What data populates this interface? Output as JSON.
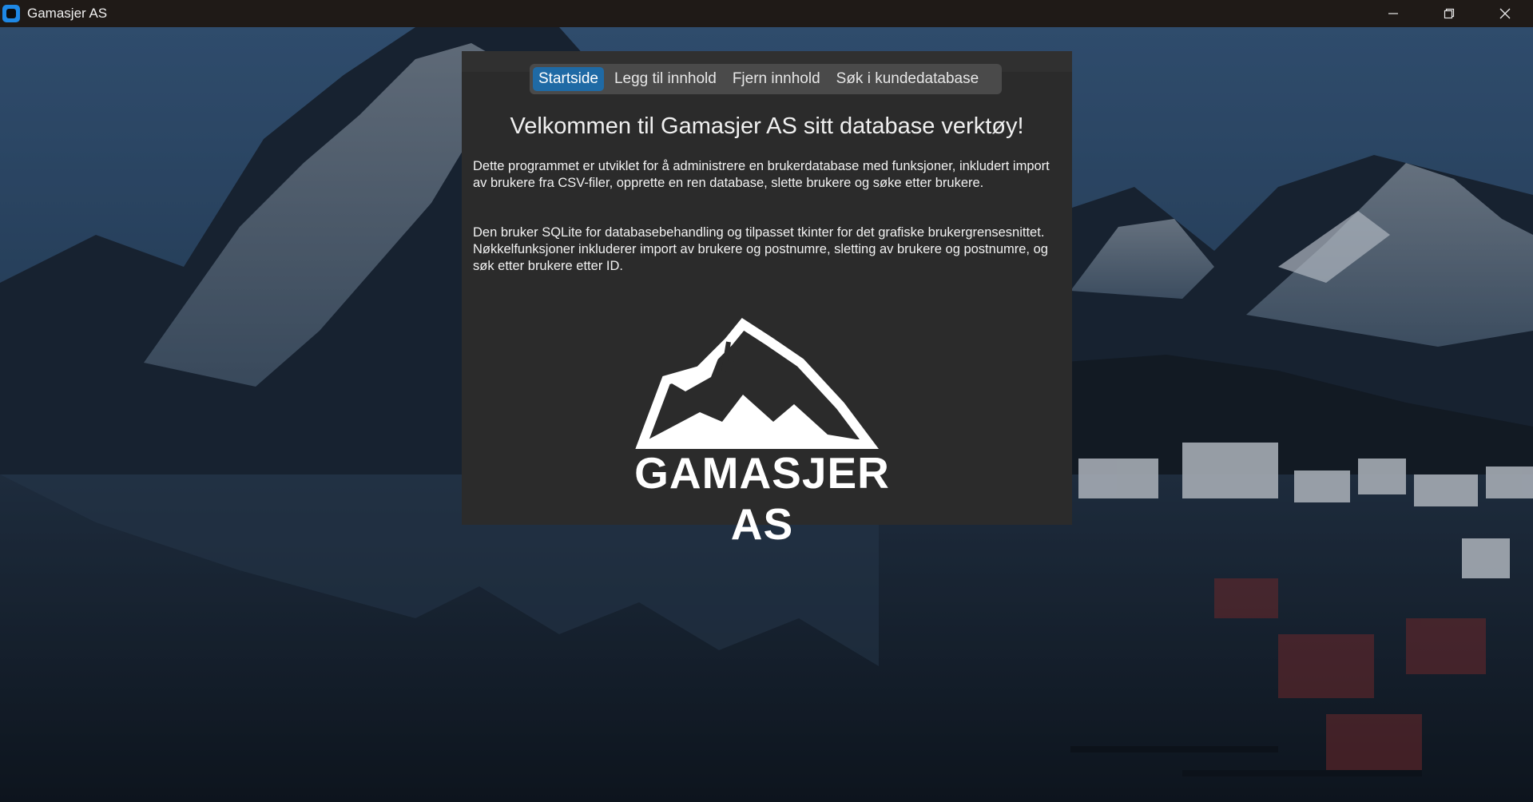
{
  "window": {
    "title": "Gamasjer AS",
    "icon": "app-icon"
  },
  "tabs": [
    {
      "label": "Startside",
      "active": true
    },
    {
      "label": "Legg til innhold",
      "active": false
    },
    {
      "label": "Fjern innhold",
      "active": false
    },
    {
      "label": "Søk i kundedatabase",
      "active": false
    }
  ],
  "main": {
    "heading": "Velkommen til Gamasjer AS sitt database verktøy!",
    "paragraph1": "Dette programmet er utviklet for å administrere en brukerdatabase med funksjoner, inkludert import av brukere fra CSV-filer, opprette en ren database, slette brukere og søke etter brukere.",
    "paragraph2": "Den bruker SQLite for databasebehandling og tilpasset tkinter for det grafiske brukergrensesnittet. Nøkkelfunksjoner inkluderer import av brukere og postnumre, sletting av brukere og postnumre, og søk etter brukere etter ID.",
    "logo_text": "GAMASJER AS"
  },
  "colors": {
    "titlebar": "#1f1a17",
    "panel": "#2b2b2b",
    "tabbar": "#4a4a4a",
    "active_tab": "#1f6aa5"
  }
}
